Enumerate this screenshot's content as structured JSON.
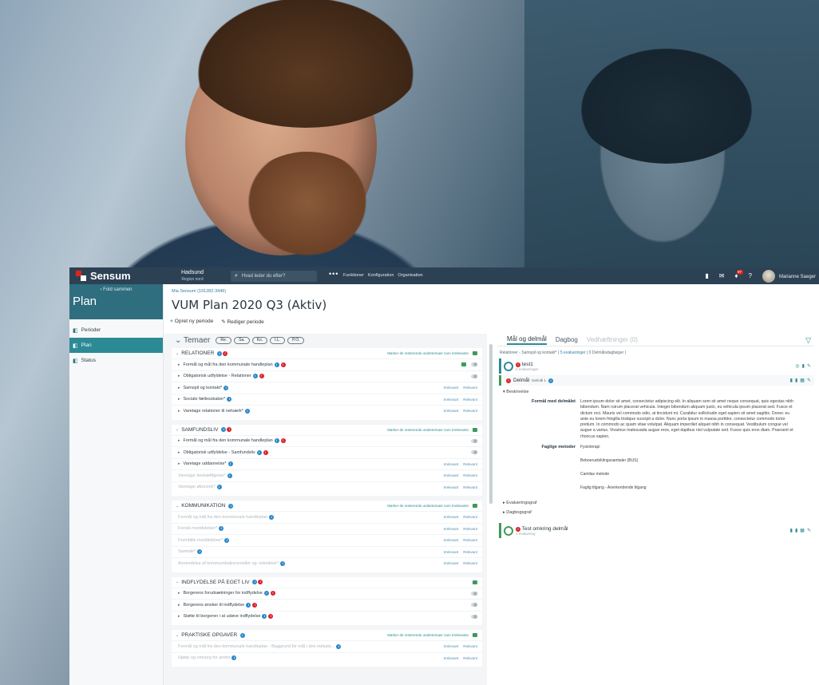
{
  "app": {
    "brand": "Sensum",
    "org_name": "Hadsund",
    "org_region": "Region nord",
    "search_placeholder": "Hvad leder du efter?",
    "more": "•••",
    "topnav": [
      "Funktioner",
      "Konfiguration",
      "Organisation"
    ],
    "notifications": "87",
    "help": "?",
    "user_name": "Marianne Saeger"
  },
  "sidebar": {
    "fold": "‹ Fold sammen",
    "title": "Plan",
    "items": [
      {
        "label": "Perioder"
      },
      {
        "label": "Plan"
      },
      {
        "label": "Status"
      }
    ]
  },
  "page": {
    "breadcrumb": "Mia Sensum (191282-3446)",
    "title": "VUM Plan 2020 Q3 (Aktiv)",
    "action_new": "Opret ny periode",
    "action_edit": "Rediger periode"
  },
  "themes": {
    "label": "Temaer",
    "pills": [
      "Re.",
      "Sa.",
      "Ko.",
      "I.L.",
      "P.O."
    ],
    "mark_text": "Marker de resterende undertemaer som irrelevante",
    "irrelevant": "Irrelevant",
    "relevant": "Relevant",
    "sections": [
      {
        "name": "RELATIONER",
        "rows": [
          {
            "label": "Formål og mål fra den kommunale handleplan"
          },
          {
            "label": "Obligatorisk udfyldelse - Relationer"
          },
          {
            "label": "Samspil og kontakt*"
          },
          {
            "label": "Sociale fællesskaber*"
          },
          {
            "label": "Varetage relationer til netværk*"
          }
        ]
      },
      {
        "name": "SAMFUNDSLIV",
        "rows": [
          {
            "label": "Formål og mål fra den kommunale handleplan"
          },
          {
            "label": "Obligatorisk udfyldelse - Samfundsliv"
          },
          {
            "label": "Varetage uddannelse*"
          },
          {
            "label": "Varetage beskæftigelse*"
          },
          {
            "label": "Varetage økonomi*"
          }
        ]
      },
      {
        "name": "KOMMUNIKATION",
        "rows": [
          {
            "label": "Formål og mål fra den kommunale handleplan"
          },
          {
            "label": "Forstå meddelelser*"
          },
          {
            "label": "Frembille meddelelser*"
          },
          {
            "label": "Samtale*"
          },
          {
            "label": "Anvendelse af kommunikationsmidler og -teknikker*"
          }
        ]
      },
      {
        "name": "INDFLYDELSE PÅ EGET LIV",
        "rows": [
          {
            "label": "Borgerens forudsætninger for indflydelse"
          },
          {
            "label": "Borgerens ønsker til indflydelse"
          },
          {
            "label": "Støtte til borgeren i at udøve indflydelse"
          }
        ]
      },
      {
        "name": "PRAKTISKE OPGAVER",
        "rows": [
          {
            "label": "Formål og mål fra den kommunale handleplan - Baggrund for mål i den indsats..."
          },
          {
            "label": "Hjælp og omsorg for andre"
          }
        ]
      }
    ]
  },
  "right": {
    "tabs": [
      "Mål og delmål",
      "Dagbog",
      "Vedhæftninger (0)"
    ],
    "relation_prefix": "Relationer - Samspil og kontakt*",
    "relation_evals": "( 5 evalueringer",
    "relation_diaries": "| 0 Delmålsdagbøger )",
    "goal1_name": "test1",
    "goal1_sub": "2 evalueringer",
    "delmal": "Delmål",
    "delmal_sub": "Delmål 1",
    "beskrivelse": "▾ Beskrivelse",
    "formaal_label": "Formål med delmålet",
    "formaal_text": "Lorem ipsum dolor sit amet, consectetur adipiscing elit. In aliquam sem sit amet neque consequat, quis egestas nibh bibendum. Nam rutrum placerat vehicula. Integer bibendum aliquam justo, eu vehicula ipsum placerat sed. Fusce et dictum orci. Mauris vel commodo odio, at tincidunt mi. Curabitur sollicitudin eget sapien sit amet sagittis. Donec eu ante eu lorem fringilla tristique suscipit a dolor. Nunc porta ipsum in massa porttitor, consectetur commodo tortor pretium. In commodo ac quam vitae volutpat. Aliquam imperdiet aliquet nibh in consequat. Vestibulum congue vel augue a varius. Vivamus malesuada augue eros, eget dapibus nisl vulputate sed. Fusce quis eros diam. Praesent et rhoncus sapien.",
    "metoder_label": "Faglige metoder",
    "metoder": [
      "Fysioterapi",
      "Beboerudviklingssamtaler (BUS)",
      "Camilas metode",
      "Faglig tilgang - Anerkendende tilgang"
    ],
    "evalueringsgraf": "▸ Evalueringsgraf",
    "dagbogsgraf": "▸ Dagbogsgraf",
    "goal2_name": "Test omkring delmål",
    "goal2_sub": "1 evaluering"
  }
}
